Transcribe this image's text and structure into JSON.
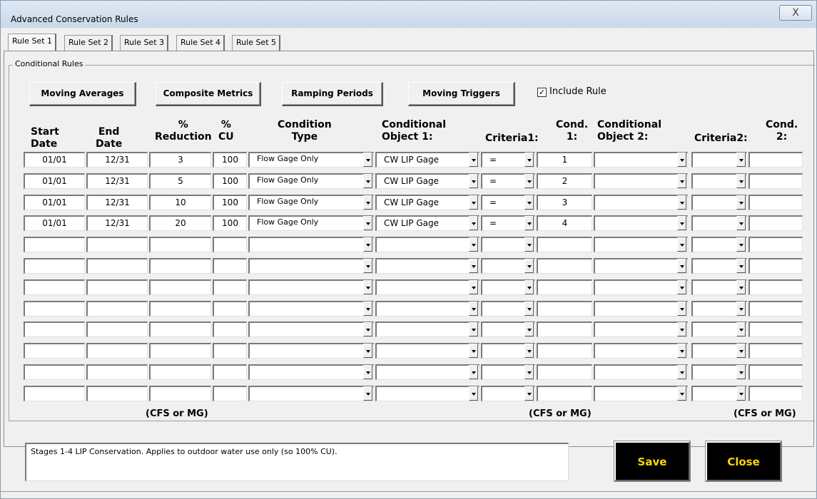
{
  "window": {
    "title": "Advanced Conservation Rules",
    "close_label": "X"
  },
  "tabs": [
    "Rule Set 1",
    "Rule Set 2",
    "Rule Set 3",
    "Rule Set 4",
    "Rule Set 5"
  ],
  "group_label": "Conditional Rules",
  "buttons": {
    "moving_averages": "Moving Averages",
    "composite_metrics": "Composite Metrics",
    "ramping_periods": "Ramping Periods",
    "moving_triggers": "Moving Triggers"
  },
  "include_rule": {
    "label": "Include Rule",
    "checked": true,
    "mark": "✓"
  },
  "headers": {
    "start_date": "Start\nDate",
    "end_date": "End\nDate",
    "pct_reduction": "%\nReduction",
    "pct_cu": "%\nCU",
    "condition_type": "Condition\nType",
    "cond_object_1": "Conditional\nObject 1:",
    "criteria1": "Criteria1:",
    "cond1": "Cond.\n1:",
    "cond_object_2": "Conditional\nObject 2:",
    "criteria2": "Criteria2:",
    "cond2": "Cond.\n2:"
  },
  "rows": [
    {
      "start": "01/01",
      "end": "12/31",
      "reduction": "3",
      "cu": "100",
      "condition_type": "Flow Gage Only",
      "object1": "CW LIP Gage",
      "criteria1": "=",
      "cond1": "1",
      "object2": "",
      "criteria2": "",
      "cond2": ""
    },
    {
      "start": "01/01",
      "end": "12/31",
      "reduction": "5",
      "cu": "100",
      "condition_type": "Flow Gage Only",
      "object1": "CW LIP Gage",
      "criteria1": "=",
      "cond1": "2",
      "object2": "",
      "criteria2": "",
      "cond2": ""
    },
    {
      "start": "01/01",
      "end": "12/31",
      "reduction": "10",
      "cu": "100",
      "condition_type": "Flow Gage Only",
      "object1": "CW LIP Gage",
      "criteria1": "=",
      "cond1": "3",
      "object2": "",
      "criteria2": "",
      "cond2": ""
    },
    {
      "start": "01/01",
      "end": "12/31",
      "reduction": "20",
      "cu": "100",
      "condition_type": "Flow Gage Only",
      "object1": "CW LIP Gage",
      "criteria1": "=",
      "cond1": "4",
      "object2": "",
      "criteria2": "",
      "cond2": ""
    },
    {
      "start": "",
      "end": "",
      "reduction": "",
      "cu": "",
      "condition_type": "",
      "object1": "",
      "criteria1": "",
      "cond1": "",
      "object2": "",
      "criteria2": "",
      "cond2": ""
    },
    {
      "start": "",
      "end": "",
      "reduction": "",
      "cu": "",
      "condition_type": "",
      "object1": "",
      "criteria1": "",
      "cond1": "",
      "object2": "",
      "criteria2": "",
      "cond2": ""
    },
    {
      "start": "",
      "end": "",
      "reduction": "",
      "cu": "",
      "condition_type": "",
      "object1": "",
      "criteria1": "",
      "cond1": "",
      "object2": "",
      "criteria2": "",
      "cond2": ""
    },
    {
      "start": "",
      "end": "",
      "reduction": "",
      "cu": "",
      "condition_type": "",
      "object1": "",
      "criteria1": "",
      "cond1": "",
      "object2": "",
      "criteria2": "",
      "cond2": ""
    },
    {
      "start": "",
      "end": "",
      "reduction": "",
      "cu": "",
      "condition_type": "",
      "object1": "",
      "criteria1": "",
      "cond1": "",
      "object2": "",
      "criteria2": "",
      "cond2": ""
    },
    {
      "start": "",
      "end": "",
      "reduction": "",
      "cu": "",
      "condition_type": "",
      "object1": "",
      "criteria1": "",
      "cond1": "",
      "object2": "",
      "criteria2": "",
      "cond2": ""
    },
    {
      "start": "",
      "end": "",
      "reduction": "",
      "cu": "",
      "condition_type": "",
      "object1": "",
      "criteria1": "",
      "cond1": "",
      "object2": "",
      "criteria2": "",
      "cond2": ""
    },
    {
      "start": "",
      "end": "",
      "reduction": "",
      "cu": "",
      "condition_type": "",
      "object1": "",
      "criteria1": "",
      "cond1": "",
      "object2": "",
      "criteria2": "",
      "cond2": ""
    }
  ],
  "units": [
    "(CFS or MG)",
    "(CFS or MG)",
    "(CFS or MG)"
  ],
  "notes": "Stages 1-4 LIP Conservation. Applies to outdoor water use only (so 100% CU).",
  "actions": {
    "save": "Save",
    "close": "Close"
  },
  "colors": {
    "action_button_bg": "#000000",
    "action_button_text": "#ffd400"
  }
}
